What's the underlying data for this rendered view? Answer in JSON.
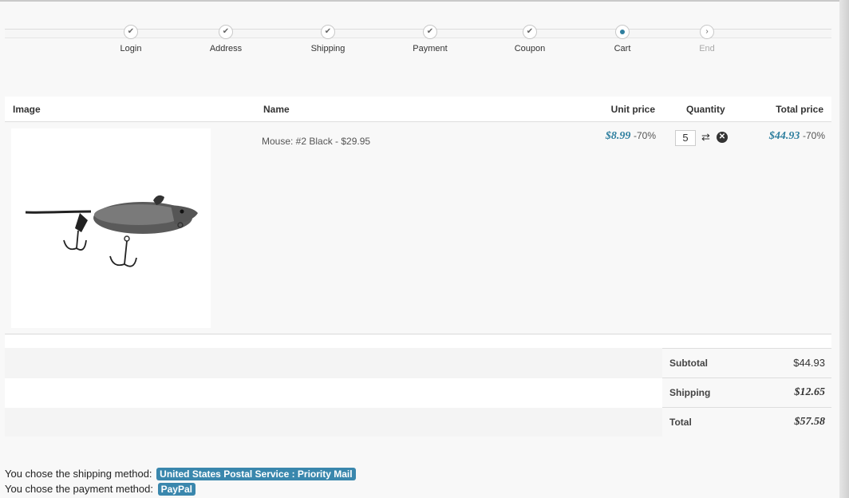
{
  "steps": [
    {
      "label": "Login",
      "state": "done"
    },
    {
      "label": "Address",
      "state": "done"
    },
    {
      "label": "Shipping",
      "state": "done"
    },
    {
      "label": "Payment",
      "state": "done"
    },
    {
      "label": "Coupon",
      "state": "done"
    },
    {
      "label": "Cart",
      "state": "current"
    },
    {
      "label": "End",
      "state": "future"
    }
  ],
  "table": {
    "headers": {
      "image": "Image",
      "name": "Name",
      "unit_price": "Unit price",
      "quantity": "Quantity",
      "total_price": "Total price"
    },
    "rows": [
      {
        "name": "Mouse: #2 Black - $29.95",
        "unit_price": "$8.99",
        "unit_discount": "-70%",
        "quantity": "5",
        "total_price": "$44.93",
        "total_discount": "-70%"
      }
    ]
  },
  "totals": {
    "subtotal_label": "Subtotal",
    "subtotal_value": "$44.93",
    "shipping_label": "Shipping",
    "shipping_value": "$12.65",
    "total_label": "Total",
    "total_value": "$57.58"
  },
  "summary": {
    "shipping_text": "You chose the shipping method:",
    "shipping_method": "United States Postal Service : Priority Mail",
    "payment_text": "You chose the payment method:",
    "payment_method": "PayPal"
  },
  "icons": {
    "step_done": "check-icon",
    "step_current": "dot-icon",
    "step_future": "chevron-right-icon",
    "refresh": "refresh-icon",
    "remove": "remove-icon"
  },
  "colors": {
    "accent": "#2f7f9f",
    "badge": "#3a87ad"
  }
}
